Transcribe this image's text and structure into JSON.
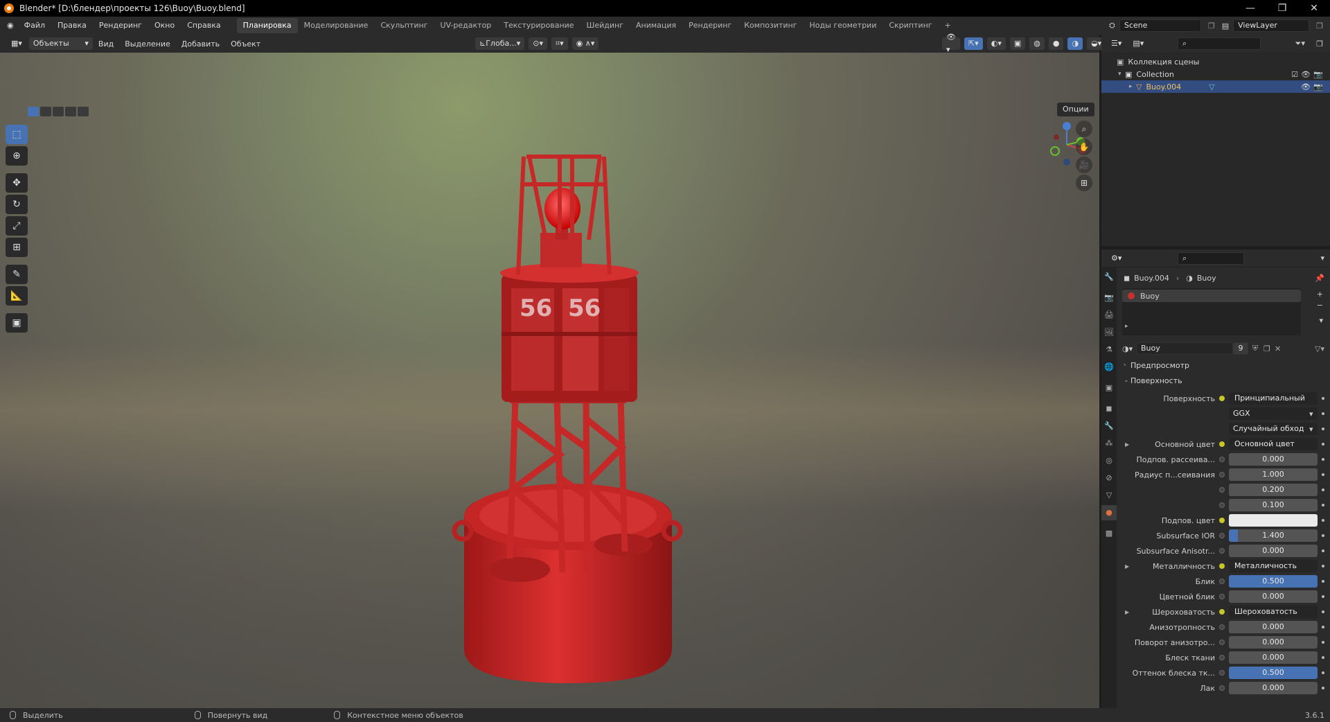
{
  "window": {
    "title": "Blender* [D:\\блендер\\проекты 126\\Buoy\\Buoy.blend]",
    "minimize": "—",
    "restore": "❐",
    "close": "✕"
  },
  "menu": [
    "Файл",
    "Правка",
    "Рендеринг",
    "Окно",
    "Справка"
  ],
  "workspaces": [
    "Планировка",
    "Моделирование",
    "Скульптинг",
    "UV-редактор",
    "Текстурирование",
    "Шейдинг",
    "Анимация",
    "Рендеринг",
    "Композитинг",
    "Ноды геометрии",
    "Скриптинг",
    "+"
  ],
  "active_workspace": "Планировка",
  "scene": "Scene",
  "view_layer": "ViewLayer",
  "viewport_header": {
    "mode": "Объекты",
    "menus": [
      "Вид",
      "Выделение",
      "Добавить",
      "Объект"
    ],
    "orientation": "Глоба...",
    "options": "Опции"
  },
  "outliner": {
    "root": "Коллекция сцены",
    "collection": "Collection",
    "object": "Buoy.004"
  },
  "properties": {
    "breadcrumb": [
      "Buoy.004",
      "Buoy"
    ],
    "material_slot": "Buoy",
    "material_name": "Buoy",
    "user_count": "9",
    "sections": {
      "preview": "Предпросмотр",
      "surface": "Поверхность"
    },
    "rows": [
      {
        "label": "Поверхность",
        "value": "Принципиальный BSDF",
        "kind": "node",
        "link": "y"
      },
      {
        "label": "",
        "value": "GGX",
        "kind": "drop"
      },
      {
        "label": "",
        "value": "Случайный обход",
        "kind": "drop"
      },
      {
        "label": "Основной цвет",
        "value": "Основной цвет",
        "kind": "node",
        "link": "y",
        "expand": true
      },
      {
        "label": "Подпов. рассеива...",
        "value": "0.000",
        "kind": "num"
      },
      {
        "label": "Радиус п...сеивания",
        "value": "1.000",
        "kind": "num"
      },
      {
        "label": "",
        "value": "0.200",
        "kind": "num"
      },
      {
        "label": "",
        "value": "0.100",
        "kind": "num"
      },
      {
        "label": "Подпов. цвет",
        "value": "",
        "kind": "white",
        "link": "y"
      },
      {
        "label": "Subsurface IOR",
        "value": "1.400",
        "kind": "num"
      },
      {
        "label": "Subsurface Anisotr...",
        "value": "0.000",
        "kind": "num"
      },
      {
        "label": "Металличность",
        "value": "Металличность",
        "kind": "node",
        "link": "y",
        "expand": true
      },
      {
        "label": "Блик",
        "value": "0.500",
        "kind": "blue"
      },
      {
        "label": "Цветной блик",
        "value": "0.000",
        "kind": "num"
      },
      {
        "label": "Шероховатость",
        "value": "Шероховатость",
        "kind": "node",
        "link": "y",
        "expand": true
      },
      {
        "label": "Анизотропность",
        "value": "0.000",
        "kind": "num"
      },
      {
        "label": "Поворот анизотро...",
        "value": "0.000",
        "kind": "num"
      },
      {
        "label": "Блеск ткани",
        "value": "0.000",
        "kind": "num"
      },
      {
        "label": "Оттенок блеска тк...",
        "value": "0.500",
        "kind": "blue"
      },
      {
        "label": "Лак",
        "value": "0.000",
        "kind": "num"
      }
    ]
  },
  "statusbar": {
    "select": "Выделить",
    "rotate": "Повернуть вид",
    "context": "Контекстное меню объектов",
    "version": "3.6.1"
  },
  "buoy_number": "56",
  "colors": {
    "accent": "#4772b3",
    "buoy_red": "#d42a2a",
    "selected_row": "#334d80",
    "active_tab": "#e07040"
  }
}
